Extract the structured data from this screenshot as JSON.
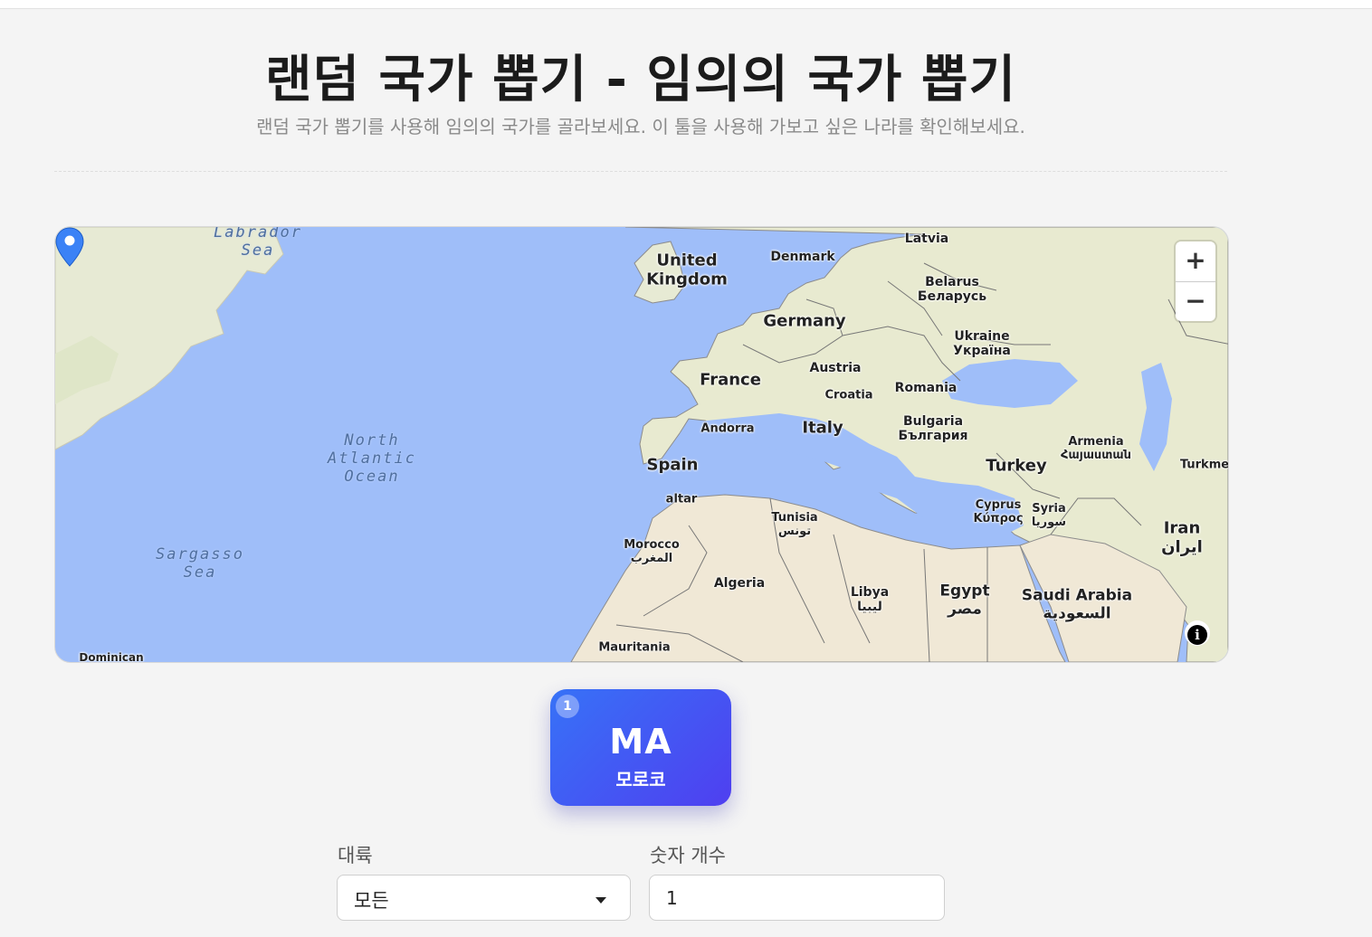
{
  "header": {
    "title": "랜덤 국가 뽑기 - 임의의 국가 뽑기",
    "subtitle": "랜덤 국가 뽑기를 사용해 임의의 국가를 골라보세요. 이 툴을 사용해 가보고 싶은 나라를 확인해보세요."
  },
  "map": {
    "zoom_in_label": "+",
    "zoom_out_label": "−",
    "info_label": "i",
    "oceans": [
      {
        "lines": [
          "Labrador",
          "Sea"
        ]
      },
      {
        "lines": [
          "North",
          "Atlantic",
          "Ocean"
        ]
      },
      {
        "lines": [
          "Sargasso",
          "Sea"
        ]
      }
    ],
    "countries": [
      {
        "name": "United\nKingdom"
      },
      {
        "name": "Denmark"
      },
      {
        "name": "Latvia"
      },
      {
        "name": "Belarus\nБеларусь"
      },
      {
        "name": "Germany"
      },
      {
        "name": "Ukraine\nУкраїна"
      },
      {
        "name": "France"
      },
      {
        "name": "Austria"
      },
      {
        "name": "Croatia"
      },
      {
        "name": "Romania"
      },
      {
        "name": "Andorra"
      },
      {
        "name": "Italy"
      },
      {
        "name": "Bulgaria\nБългария"
      },
      {
        "name": "Armenia\nՀայաստան"
      },
      {
        "name": "Spain"
      },
      {
        "name": "altar"
      },
      {
        "name": "Turkey"
      },
      {
        "name": "Turkme"
      },
      {
        "name": "Tunisia\nتونس"
      },
      {
        "name": "Cyprus\nΚύπρος"
      },
      {
        "name": "Syria\nسوريا"
      },
      {
        "name": "Morocco\nالمغرب"
      },
      {
        "name": "Iran\nایران"
      },
      {
        "name": "Algeria"
      },
      {
        "name": "Libya\nليبيا"
      },
      {
        "name": "Egypt\nمصر"
      },
      {
        "name": "Saudi Arabia\nالسعودية"
      },
      {
        "name": "Mauritania"
      },
      {
        "name": "Dominican"
      }
    ]
  },
  "result": {
    "index": "1",
    "code": "MA",
    "name": "모로코"
  },
  "form": {
    "continent_label": "대륙",
    "continent_value": "모든",
    "count_label": "숫자 개수",
    "count_value": "1"
  }
}
